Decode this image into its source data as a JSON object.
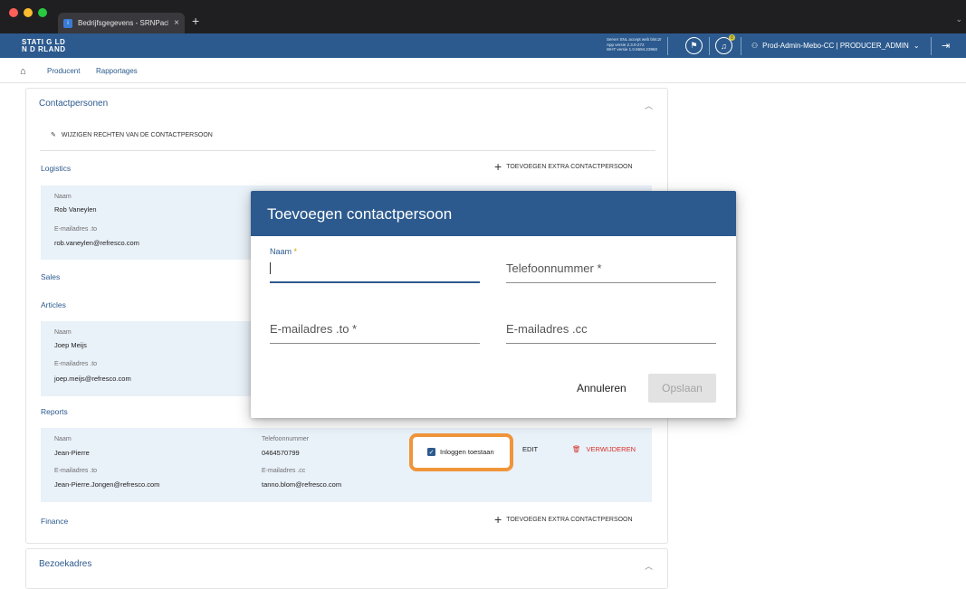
{
  "browser": {
    "tab_title": "Bedrijfsgegevens - SRNPack",
    "tab_close": "×",
    "new_tab": "+"
  },
  "header": {
    "logo_line1": "STATI G LD",
    "logo_line2": "N D RLAND",
    "build_info": {
      "server": "Server SNL accept web bl4c2r",
      "app": "App versie 2.3.0-272",
      "whk": "WHT versie 1.0.6694.23960"
    },
    "notification_count": "0",
    "user": "Prod-Admin-Mebo-CC | PRODUCER_ADMIN"
  },
  "nav": {
    "items": [
      "Producent",
      "Rapportages"
    ]
  },
  "contact_card": {
    "title": "Contactpersonen",
    "edit_rights": "WIJZIGEN RECHTEN VAN DE CONTACTPERSOON",
    "add_extra": "TOEVOEGEN EXTRA CONTACTPERSOON",
    "sections": {
      "logistics": "Logistics",
      "sales": "Sales",
      "articles": "Articles",
      "reports": "Reports",
      "finance": "Finance"
    },
    "labels": {
      "name": "Naam",
      "email_to": "E-mailadres .to",
      "phone": "Telefoonnummer",
      "email_cc": "E-mailadres .cc"
    },
    "persons": {
      "logistics": {
        "name": "Rob Vaneylen",
        "email_to": "rob.vaneylen@refresco.com"
      },
      "articles": {
        "name": "Joep Meijs",
        "email_to": "joep.meijs@refresco.com"
      },
      "reports": {
        "name": "Jean-Pierre",
        "email_to": "Jean-Pierre.Jongen@refresco.com",
        "phone": "0464570799",
        "email_cc": "tanno.blom@refresco.com",
        "login_allowed": "Inloggen toestaan",
        "edit": "EDIT",
        "delete": "VERWIJDEREN"
      }
    }
  },
  "visit_card": {
    "title": "Bezoekadres"
  },
  "dialog": {
    "title": "Toevoegen contactpersoon",
    "fields": {
      "name": "Naam",
      "phone": "Telefoonnummer *",
      "email_to": "E-mailadres .to *",
      "email_cc": "E-mailadres .cc"
    },
    "required_mark": " *",
    "cancel": "Annuleren",
    "save": "Opslaan"
  }
}
